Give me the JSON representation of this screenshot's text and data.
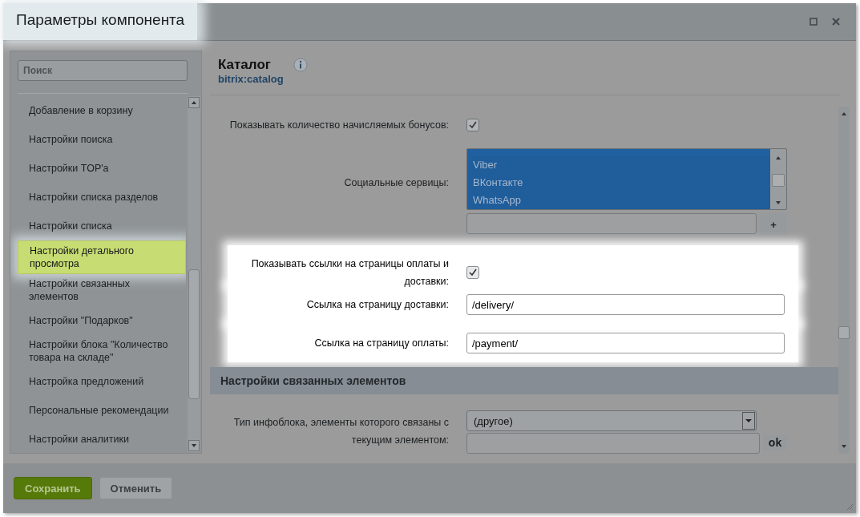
{
  "window": {
    "title": "Параметры компонента",
    "highlighted": true
  },
  "sidebar": {
    "search": {
      "placeholder": "Поиск"
    },
    "items": [
      {
        "label": "Добавление в корзину",
        "selected": false
      },
      {
        "label": "Настройки поиска",
        "selected": false
      },
      {
        "label": "Настройки TOP'а",
        "selected": false
      },
      {
        "label": "Настройки списка разделов",
        "selected": false
      },
      {
        "label": "Настройки списка",
        "selected": false
      },
      {
        "label": "Настройки детального просмотра",
        "selected": true
      },
      {
        "label": "Настройки связанных элементов",
        "selected": false
      },
      {
        "label": "Настройки \"Подарков\"",
        "selected": false
      },
      {
        "label": "Настройки блока \"Количество товара на складе\"",
        "selected": false
      },
      {
        "label": "Настройка предложений",
        "selected": false
      },
      {
        "label": "Персональные рекомендации",
        "selected": false
      },
      {
        "label": "Настройки аналитики",
        "selected": false
      }
    ]
  },
  "component": {
    "name": "Каталог",
    "code": "bitrix:catalog"
  },
  "rows": [
    {
      "kind": "checkbox",
      "label": "Показывать количество начисляемых бонусов:",
      "checked": true,
      "highlighted": false
    },
    {
      "kind": "listbox",
      "label": "Социальные сервицы:",
      "options": [
        {
          "label": "Viber",
          "selected": true
        },
        {
          "label": "ВКонтакте",
          "selected": true
        },
        {
          "label": "WhatsApp",
          "selected": true
        }
      ],
      "add_button": "+",
      "highlighted": false
    },
    {
      "kind": "checkbox",
      "label": "Показывать ссылки на страницы оплаты и доставки:",
      "checked": true,
      "highlighted": true
    },
    {
      "kind": "text",
      "label": "Ссылка на страницу доставки:",
      "value": "/delivery/",
      "highlighted": true
    },
    {
      "kind": "text",
      "label": "Ссылка на страницу оплаты:",
      "value": "/payment/",
      "highlighted": true
    },
    {
      "kind": "section",
      "title": "Настройки связанных элементов"
    },
    {
      "kind": "select",
      "label": "Тип инфоблока, элементы которого связаны с текущим элементом:",
      "value": "(другое)",
      "extra_button": "ok",
      "highlighted": false
    }
  ],
  "buttons": [
    {
      "label": "Сохранить",
      "kind": "primary"
    },
    {
      "label": "Отменить",
      "kind": "secondary"
    }
  ]
}
